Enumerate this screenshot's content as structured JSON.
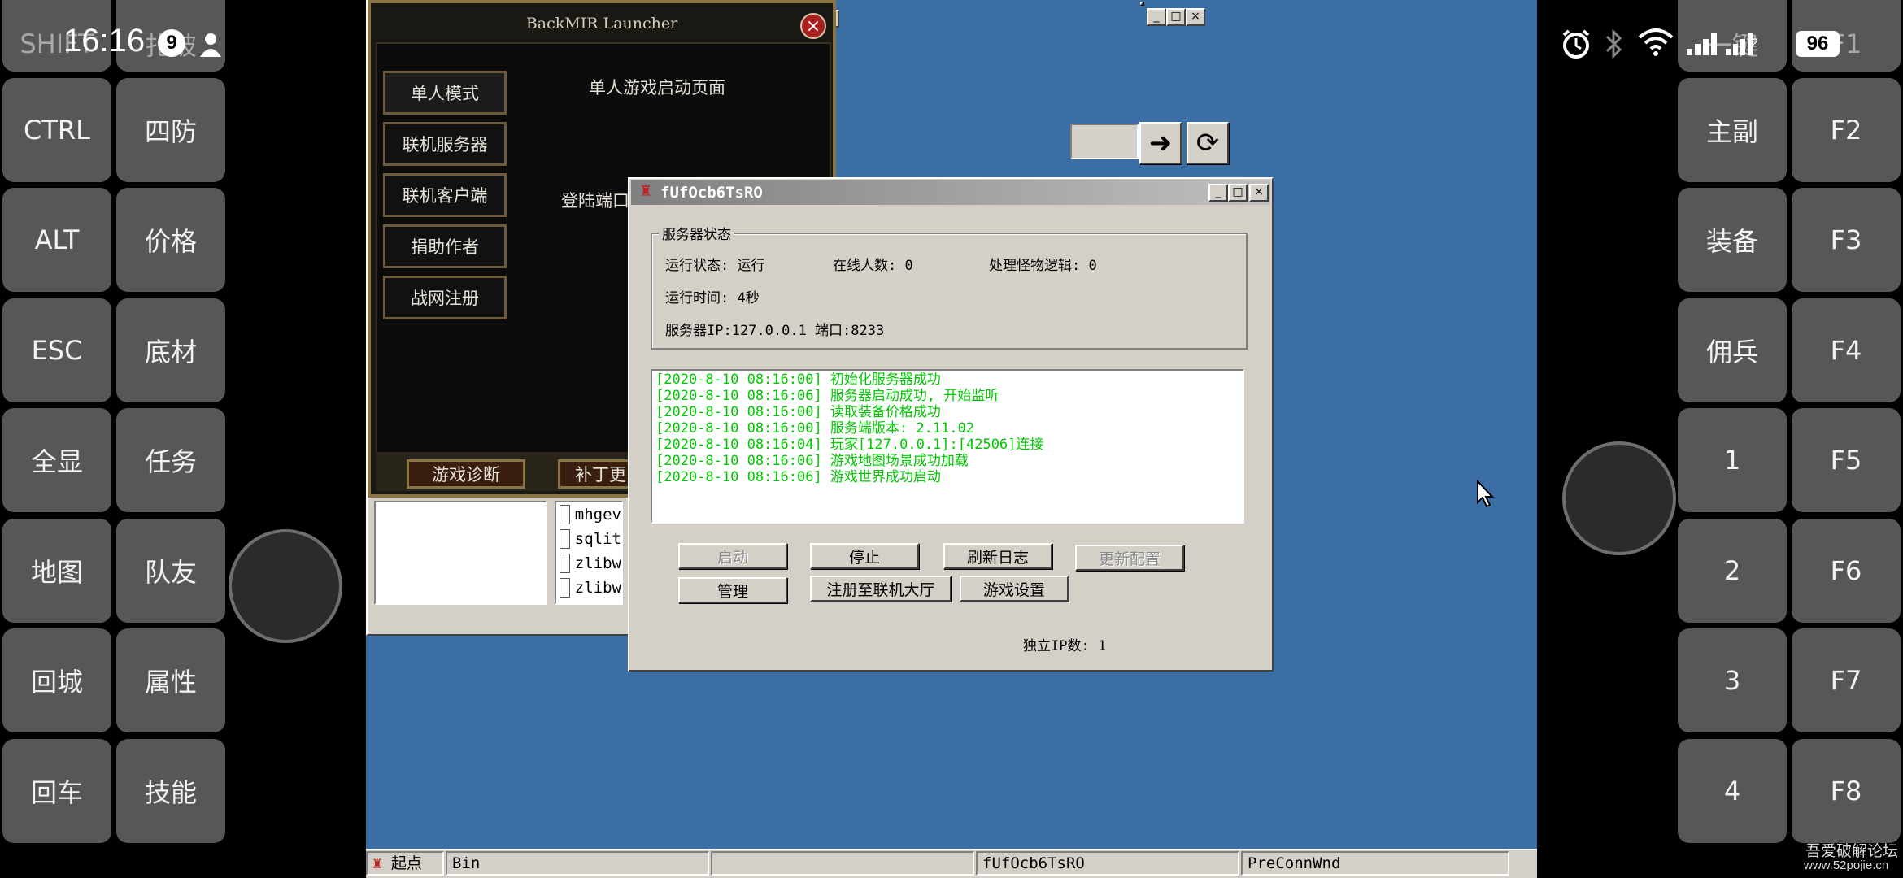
{
  "status_bar": {
    "time": "16:16",
    "notif_count": "9",
    "battery": "96",
    "sim_number": "2"
  },
  "left_keys": [
    [
      "SHIFT",
      "扎破"
    ],
    [
      "CTRL",
      "四防"
    ],
    [
      "ALT",
      "价格"
    ],
    [
      "ESC",
      "底材"
    ],
    [
      "全显",
      "任务"
    ],
    [
      "地图",
      "队友"
    ],
    [
      "回城",
      "属性"
    ],
    [
      "回车",
      "技能"
    ]
  ],
  "right_keys": [
    [
      "一键",
      "F1"
    ],
    [
      "主副",
      "F2"
    ],
    [
      "装备",
      "F3"
    ],
    [
      "佣兵",
      "F4"
    ],
    [
      "1",
      "F5"
    ],
    [
      "2",
      "F6"
    ],
    [
      "3",
      "F7"
    ],
    [
      "4",
      "F8"
    ]
  ],
  "launcher": {
    "title": "BackMIR Launcher",
    "page_heading": "单人游戏启动页面",
    "menu": [
      "单人模式",
      "联机服务器",
      "联机客户端",
      "捐助作者",
      "战网注册"
    ],
    "login_port_label": "登陆端口",
    "bottom_buttons": [
      "游戏诊断",
      "补丁更"
    ]
  },
  "explorer": {
    "files": [
      "mhgev",
      "sqlit",
      "zlibw",
      "zlibw"
    ]
  },
  "server_window": {
    "title": "fUfOcb6TsRO",
    "group_title": "服务器状态",
    "run_state": "运行状态: 运行",
    "online": "在线人数: 0",
    "monster_logic": "处理怪物逻辑: 0",
    "run_time": "运行时间: 4秒",
    "server_ip": "服务器IP:127.0.0.1 端口:8233",
    "log": [
      "[2020-8-10 08:16:00] 初始化服务器成功",
      "[2020-8-10 08:16:06] 服务器启动成功, 开始监听",
      "[2020-8-10 08:16:00] 读取装备价格成功",
      "[2020-8-10 08:16:00] 服务端版本: 2.11.02",
      "[2020-8-10 08:16:04] 玩家[127.0.0.1]:[42506]连接",
      "[2020-8-10 08:16:06] 游戏地图场景成功加载",
      "[2020-8-10 08:16:06] 游戏世界成功启动"
    ],
    "buttons": {
      "start": "启动",
      "stop": "停止",
      "refresh_log": "刷新日志",
      "update_config": "更新配置",
      "manage": "管理",
      "register_lobby": "注册至联机大厅",
      "game_settings": "游戏设置"
    },
    "unique_ip": "独立IP数: 1"
  },
  "taskbar": {
    "start_label": "起点",
    "cells": [
      "Bin",
      "",
      "fUfOcb6TsRO",
      "PreConnWnd"
    ]
  },
  "watermark": {
    "line1": "吾爱破解论坛",
    "line2": "www.52pojie.cn"
  }
}
